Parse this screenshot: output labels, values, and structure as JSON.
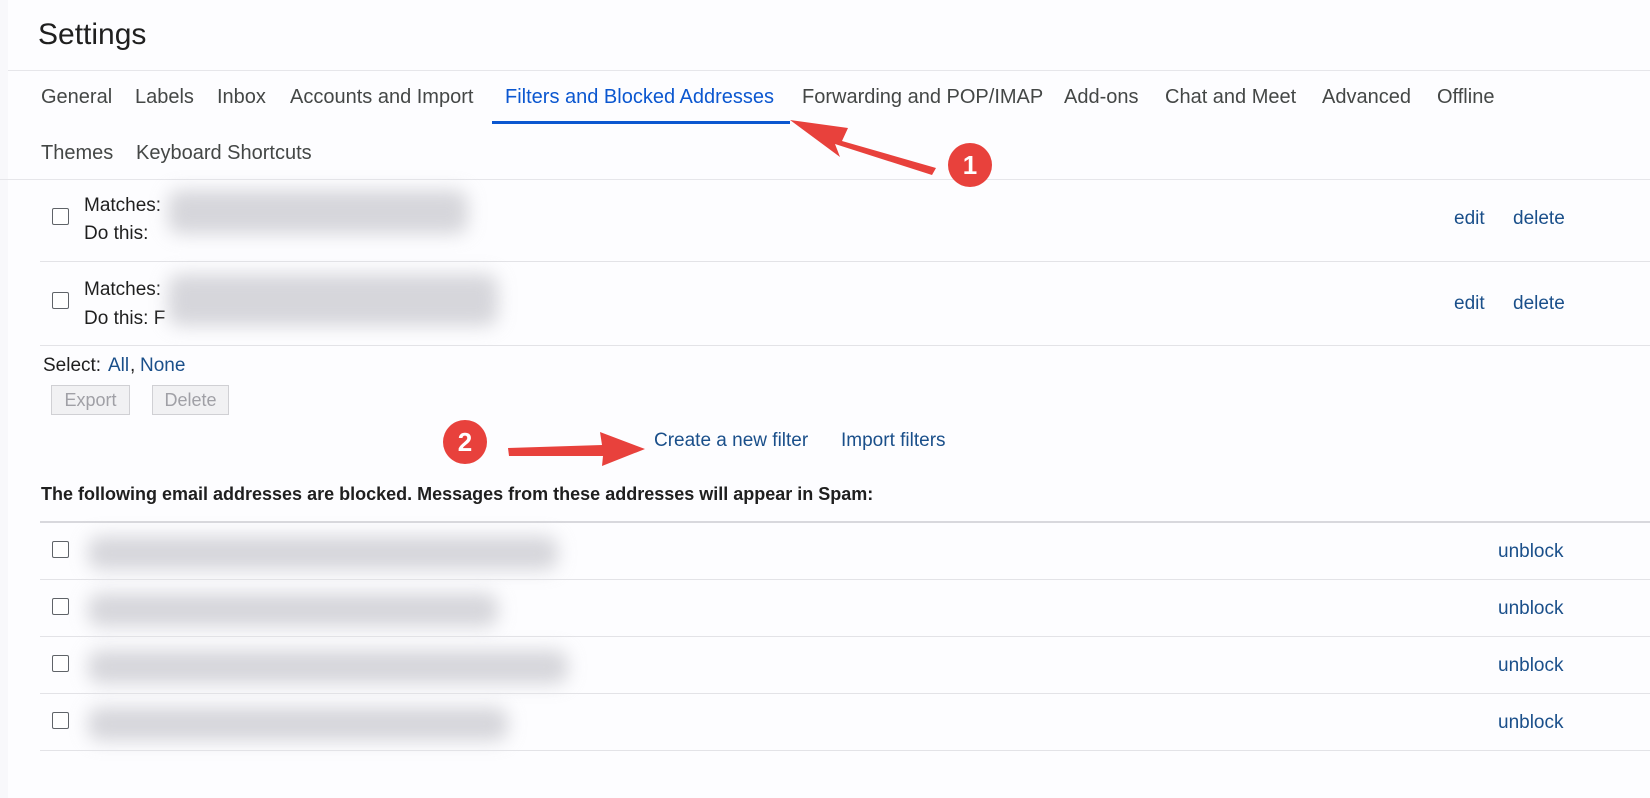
{
  "page": {
    "title": "Settings"
  },
  "tabs": [
    {
      "label": "General"
    },
    {
      "label": "Labels"
    },
    {
      "label": "Inbox"
    },
    {
      "label": "Accounts and Import"
    },
    {
      "label": "Filters and Blocked Addresses",
      "active": true
    },
    {
      "label": "Forwarding and POP/IMAP"
    },
    {
      "label": "Add-ons"
    },
    {
      "label": "Chat and Meet"
    },
    {
      "label": "Advanced"
    },
    {
      "label": "Offline"
    },
    {
      "label": "Themes"
    },
    {
      "label": "Keyboard Shortcuts"
    }
  ],
  "filters": [
    {
      "matches_label": "Matches:",
      "action_label": "Do this:",
      "edit": "edit",
      "delete": "delete"
    },
    {
      "matches_label": "Matches:",
      "action_label": "Do this: F",
      "edit": "edit",
      "delete": "delete"
    }
  ],
  "select": {
    "label": "Select:",
    "all": "All",
    "separator": ",",
    "none": "None"
  },
  "buttons": {
    "export": "Export",
    "delete": "Delete"
  },
  "actions": {
    "create_filter": "Create a new filter",
    "import_filters": "Import filters"
  },
  "blocked": {
    "heading": "The following email addresses are blocked. Messages from these addresses will appear in Spam:",
    "unblock_label": "unblock"
  },
  "annotations": {
    "step1": "1",
    "step2": "2",
    "color": "#e8413c"
  },
  "colors": {
    "accent": "#0b57d0",
    "link": "#1a4f8a"
  }
}
